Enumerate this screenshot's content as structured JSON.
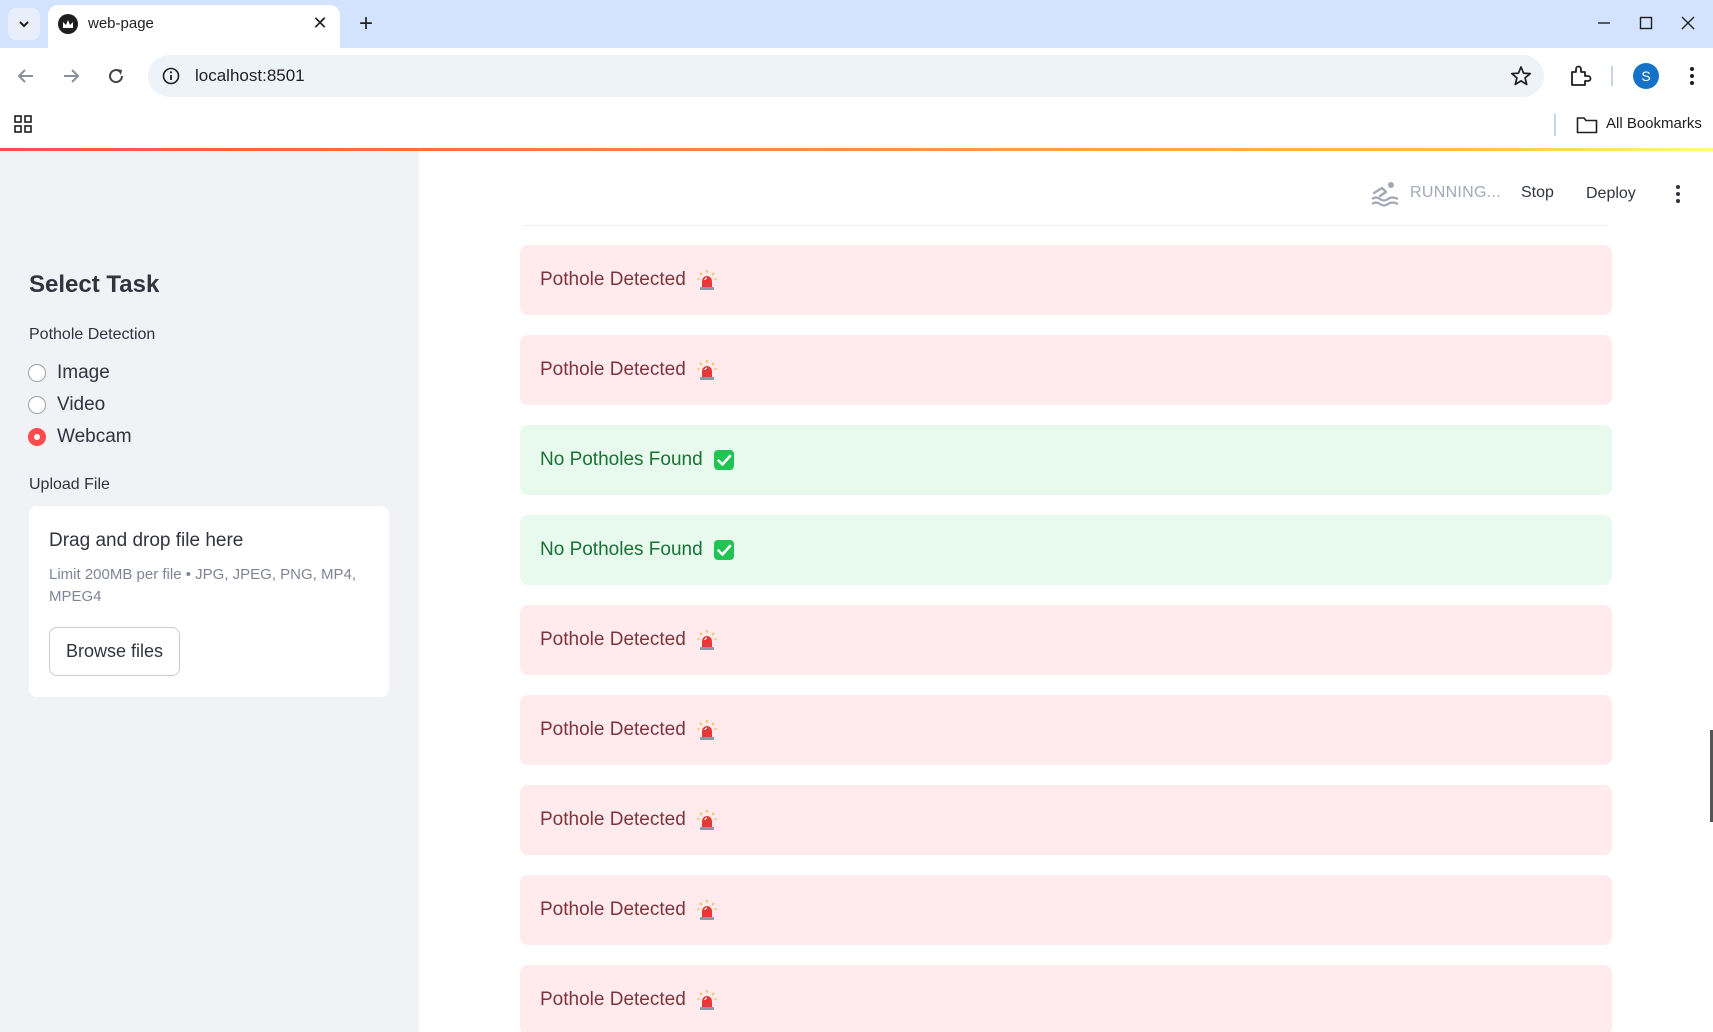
{
  "browser": {
    "tab_title": "web-page",
    "url": "localhost:8501",
    "profile_initial": "S",
    "bookmarks_label": "All Bookmarks"
  },
  "app": {
    "status_text": "RUNNING...",
    "stop_label": "Stop",
    "deploy_label": "Deploy"
  },
  "sidebar": {
    "title": "Select Task",
    "radio_group_label": "Pothole Detection",
    "options": [
      {
        "label": "Image",
        "selected": false
      },
      {
        "label": "Video",
        "selected": false
      },
      {
        "label": "Webcam",
        "selected": true
      }
    ],
    "upload_label": "Upload File",
    "dropzone_title": "Drag and drop file here",
    "dropzone_limit": "Limit 200MB per file • JPG, JPEG, PNG, MP4, MPEG4",
    "browse_label": "Browse files"
  },
  "alerts": [
    {
      "type": "error",
      "text": "Pothole Detected",
      "icon": "siren-icon"
    },
    {
      "type": "error",
      "text": "Pothole Detected",
      "icon": "siren-icon"
    },
    {
      "type": "success",
      "text": "No Potholes Found",
      "icon": "check-mark-icon"
    },
    {
      "type": "success",
      "text": "No Potholes Found",
      "icon": "check-mark-icon"
    },
    {
      "type": "error",
      "text": "Pothole Detected",
      "icon": "siren-icon"
    },
    {
      "type": "error",
      "text": "Pothole Detected",
      "icon": "siren-icon"
    },
    {
      "type": "error",
      "text": "Pothole Detected",
      "icon": "siren-icon"
    },
    {
      "type": "error",
      "text": "Pothole Detected",
      "icon": "siren-icon"
    },
    {
      "type": "error",
      "text": "Pothole Detected",
      "icon": "siren-icon"
    }
  ],
  "colors": {
    "accent": "#ff4b4b",
    "error_bg": "#ffebee",
    "error_text": "#7d353b",
    "success_bg": "#e8f9ee",
    "success_text": "#177233"
  }
}
